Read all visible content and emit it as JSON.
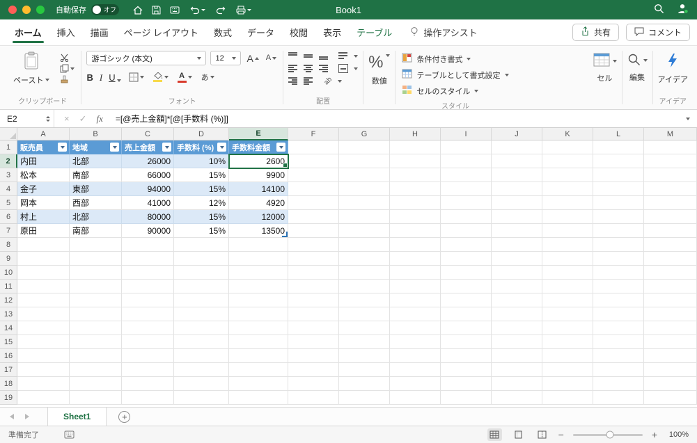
{
  "titlebar": {
    "autosave_label": "自動保存",
    "autosave_state": "オフ",
    "title": "Book1"
  },
  "ribbon_tabs": [
    {
      "label": "ホーム",
      "active": true
    },
    {
      "label": "挿入"
    },
    {
      "label": "描画"
    },
    {
      "label": "ページ レイアウト"
    },
    {
      "label": "数式"
    },
    {
      "label": "データ"
    },
    {
      "label": "校閲"
    },
    {
      "label": "表示"
    },
    {
      "label": "テーブル",
      "contextual": true
    }
  ],
  "tellme_label": "操作アシスト",
  "actions": {
    "share": "共有",
    "comments": "コメント"
  },
  "ribbon": {
    "clipboard": {
      "group_label": "クリップボード",
      "paste_label": "ペースト"
    },
    "font": {
      "group_label": "フォント",
      "font_name": "游ゴシック (本文)",
      "font_size": "12"
    },
    "alignment": {
      "group_label": "配置"
    },
    "number": {
      "button_label": "数値"
    },
    "styles": {
      "group_label": "スタイル",
      "conditional_label": "条件付き書式",
      "format_table_label": "テーブルとして書式設定",
      "cell_styles_label": "セルのスタイル"
    },
    "cells": {
      "button_label": "セル"
    },
    "editing": {
      "button_label": "編集"
    },
    "ideas": {
      "button_label": "アイデア",
      "group_label": "アイデア"
    }
  },
  "formula_bar": {
    "name_box": "E2",
    "formula": "=[@売上金額]*[@[手数料 (%)]]"
  },
  "sheet": {
    "columns": [
      "A",
      "B",
      "C",
      "D",
      "E",
      "F",
      "G",
      "H",
      "I",
      "J",
      "K",
      "L",
      "M"
    ],
    "row_count": 19,
    "selected_col": "E",
    "selected_row": 2,
    "selected_cell": "E2",
    "table": {
      "headers": [
        "販売員",
        "地域",
        "売上金額",
        "手数料 (%)",
        "手数料金額"
      ],
      "rows": [
        [
          "内田",
          "北部",
          "26000",
          "10%",
          "2600"
        ],
        [
          "松本",
          "南部",
          "66000",
          "15%",
          "9900"
        ],
        [
          "金子",
          "東部",
          "94000",
          "15%",
          "14100"
        ],
        [
          "岡本",
          "西部",
          "41000",
          "12%",
          "4920"
        ],
        [
          "村上",
          "北部",
          "80000",
          "15%",
          "12000"
        ],
        [
          "原田",
          "南部",
          "90000",
          "15%",
          "13500"
        ]
      ]
    }
  },
  "sheet_tabs": {
    "tabs": [
      "Sheet1"
    ]
  },
  "status_bar": {
    "ready_label": "準備完了",
    "zoom": "100%"
  },
  "colors": {
    "accent": "#217346",
    "table_header": "#5B9BD5",
    "band": "#DCE9F7"
  }
}
